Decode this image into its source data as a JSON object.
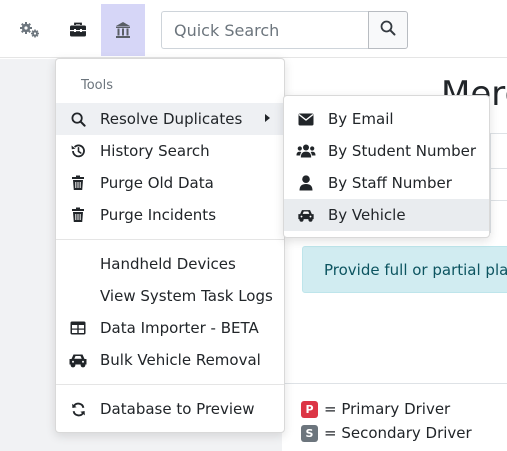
{
  "search": {
    "placeholder": "Quick Search"
  },
  "page": {
    "heading": "Merg",
    "info_text": "Provide full or partial plate",
    "legend": [
      {
        "badge": "P",
        "label": "= Primary Driver",
        "color": "#dc3545"
      },
      {
        "badge": "S",
        "label": "= Secondary Driver",
        "color": "#6c757d"
      }
    ]
  },
  "tools_menu": {
    "header": "Tools",
    "items": [
      {
        "label": "Resolve Duplicates",
        "icon": "search-icon",
        "has_submenu": true
      },
      {
        "label": "History Search",
        "icon": "history-icon"
      },
      {
        "label": "Purge Old Data",
        "icon": "trash-icon"
      },
      {
        "label": "Purge Incidents",
        "icon": "trash-icon"
      },
      {
        "label": "Handheld Devices",
        "icon": ""
      },
      {
        "label": "View System Task Logs",
        "icon": ""
      },
      {
        "label": "Data Importer - BETA",
        "icon": "table-icon"
      },
      {
        "label": "Bulk Vehicle Removal",
        "icon": "car-icon"
      },
      {
        "label": "Database to Preview",
        "icon": "sync-icon"
      }
    ]
  },
  "submenu": {
    "items": [
      {
        "label": "By Email",
        "icon": "envelope-icon"
      },
      {
        "label": "By Student Number",
        "icon": "users-icon"
      },
      {
        "label": "By Staff Number",
        "icon": "user-icon"
      },
      {
        "label": "By Vehicle",
        "icon": "car-icon",
        "active": true
      }
    ]
  }
}
